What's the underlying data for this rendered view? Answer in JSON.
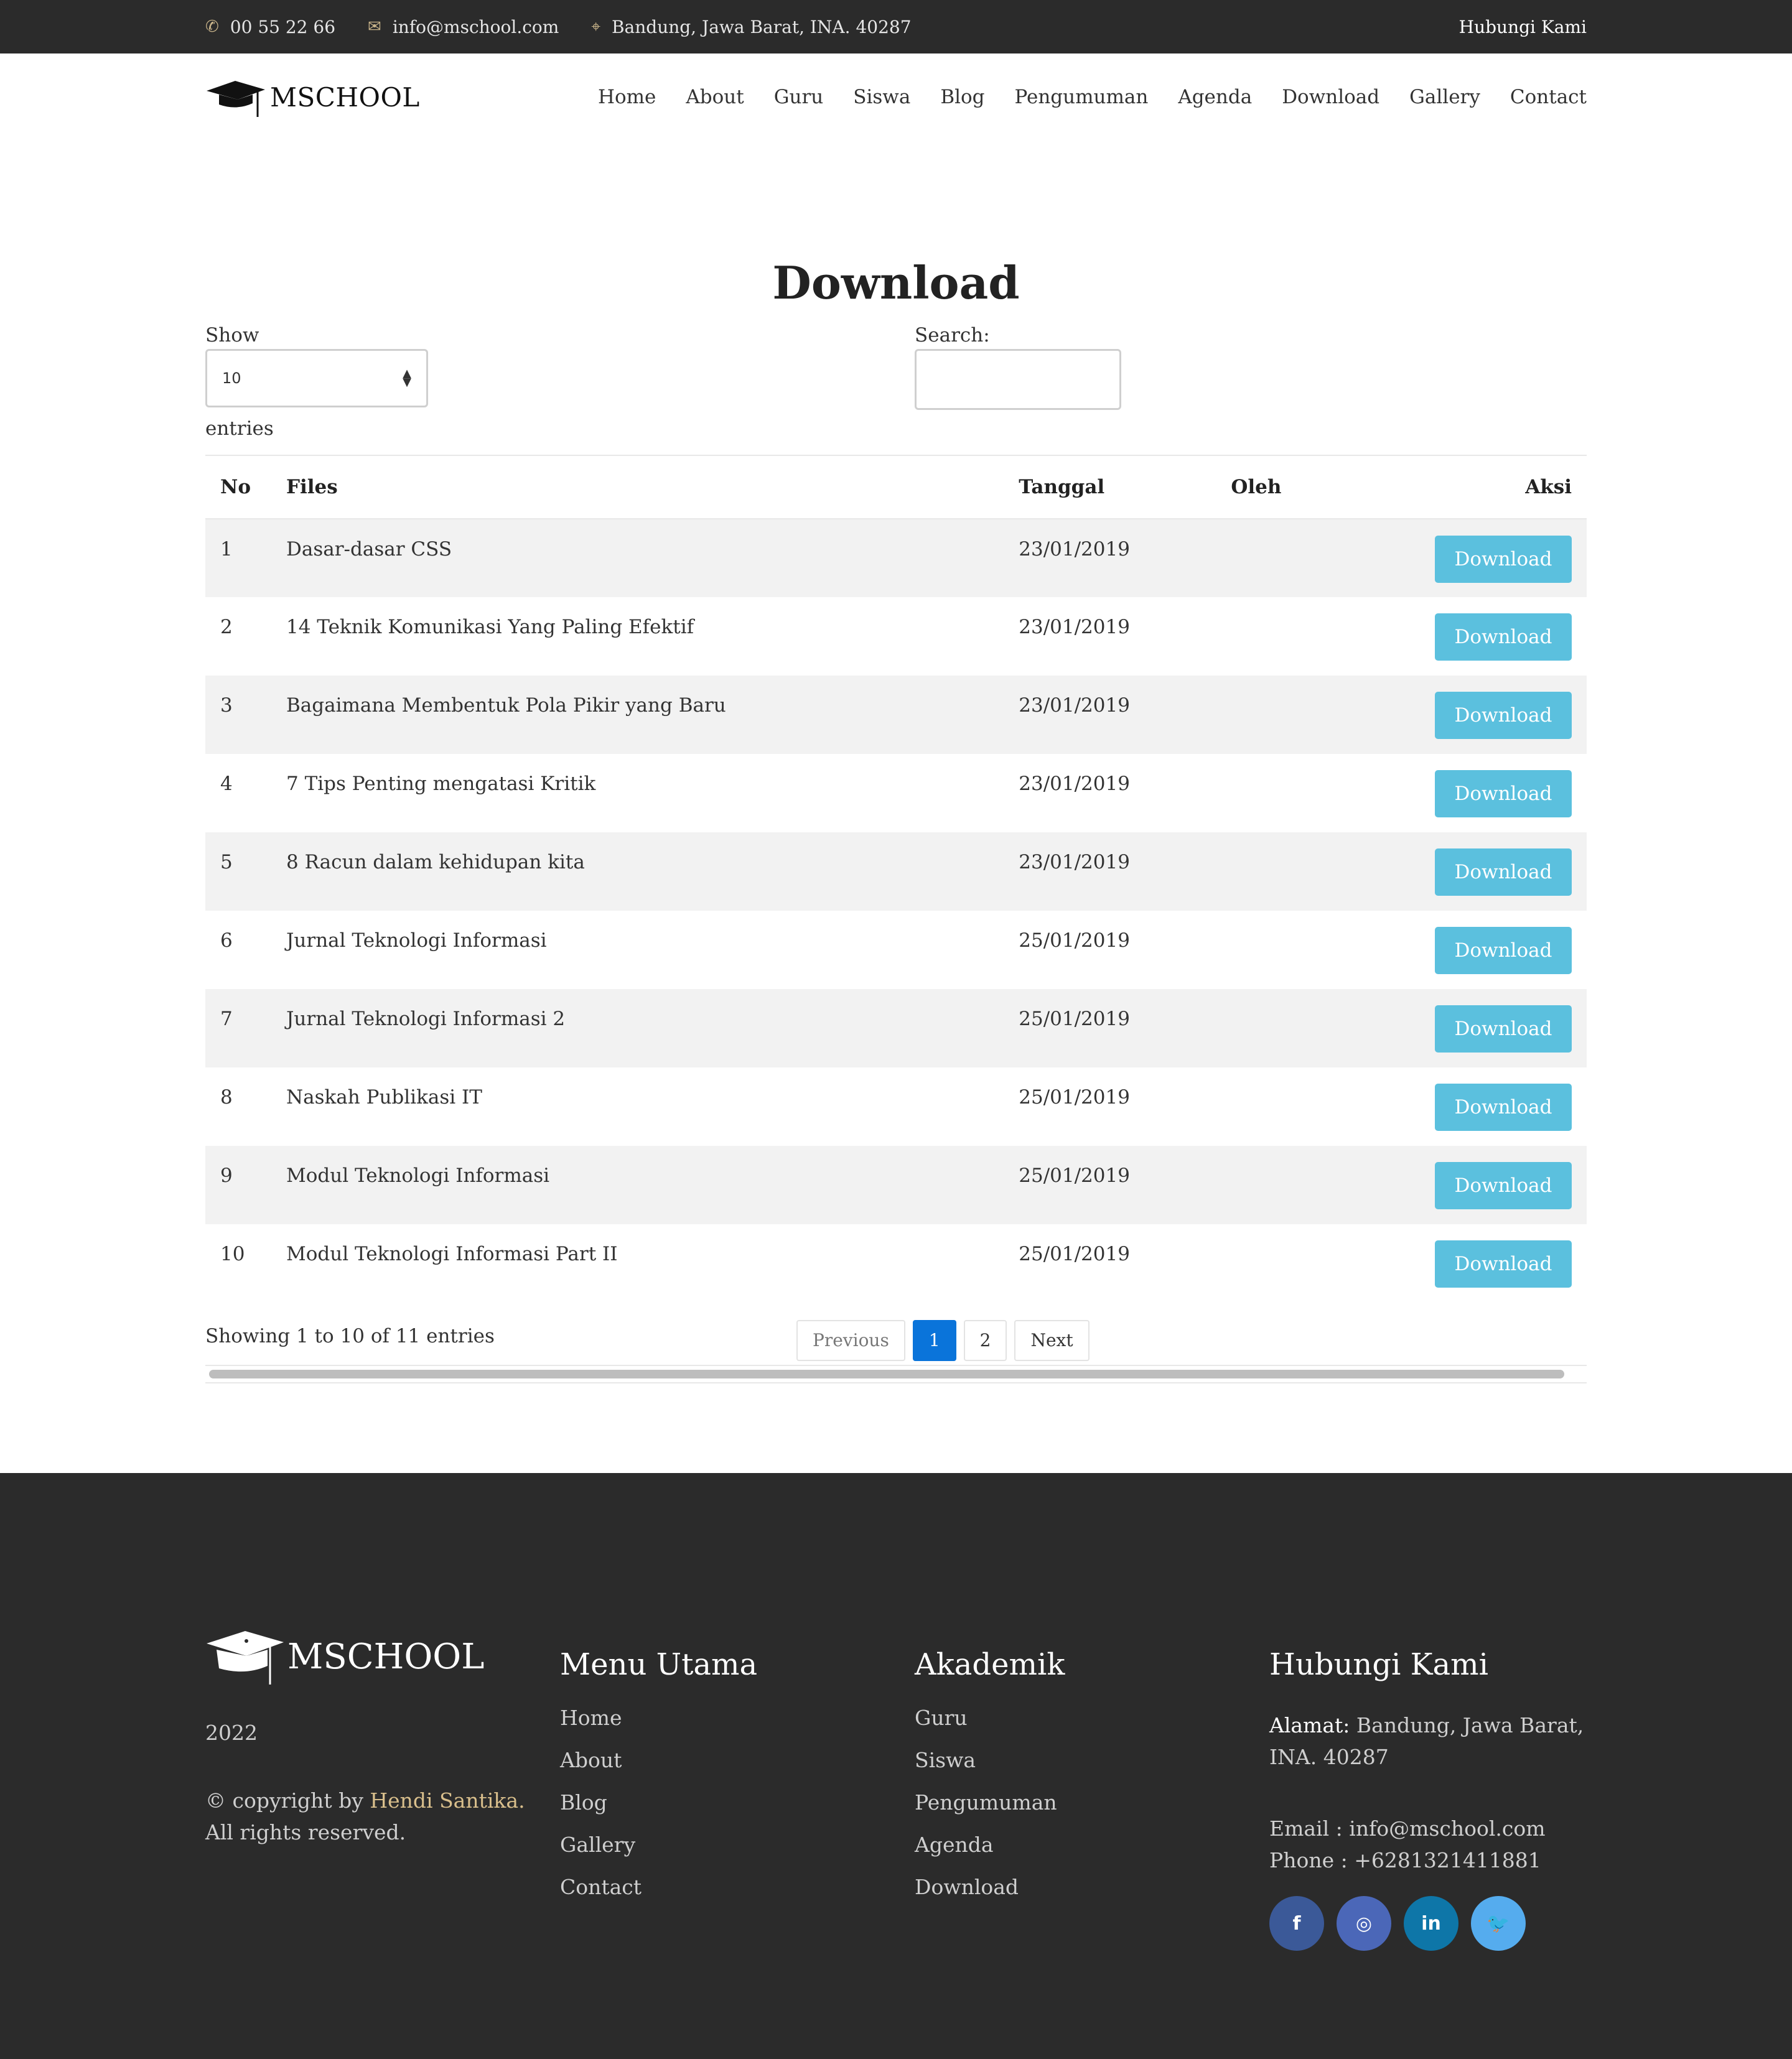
{
  "topbar": {
    "phone": "00 55 22 66",
    "email": "info@mschool.com",
    "address": "Bandung, Jawa Barat, INA. 40287",
    "contact_link": "Hubungi Kami"
  },
  "brand": {
    "name": "MSCHOOL"
  },
  "nav": [
    "Home",
    "About",
    "Guru",
    "Siswa",
    "Blog",
    "Pengumuman",
    "Agenda",
    "Download",
    "Gallery",
    "Contact"
  ],
  "page": {
    "title": "Download",
    "show_label": "Show",
    "show_value": "10",
    "entries_label": "entries",
    "search_label": "Search:",
    "search_value": ""
  },
  "table": {
    "headers": [
      "No",
      "Files",
      "Tanggal",
      "Oleh",
      "Aksi"
    ],
    "rows": [
      {
        "no": "1",
        "file": "Dasar-dasar CSS",
        "date": "23/01/2019",
        "oleh": "",
        "action": "Download"
      },
      {
        "no": "2",
        "file": "14 Teknik Komunikasi Yang Paling Efektif",
        "date": "23/01/2019",
        "oleh": "",
        "action": "Download"
      },
      {
        "no": "3",
        "file": "Bagaimana Membentuk Pola Pikir yang Baru",
        "date": "23/01/2019",
        "oleh": "",
        "action": "Download"
      },
      {
        "no": "4",
        "file": "7 Tips Penting mengatasi Kritik",
        "date": "23/01/2019",
        "oleh": "",
        "action": "Download"
      },
      {
        "no": "5",
        "file": "8 Racun dalam kehidupan kita",
        "date": "23/01/2019",
        "oleh": "",
        "action": "Download"
      },
      {
        "no": "6",
        "file": "Jurnal Teknologi Informasi",
        "date": "25/01/2019",
        "oleh": "",
        "action": "Download"
      },
      {
        "no": "7",
        "file": "Jurnal Teknologi Informasi 2",
        "date": "25/01/2019",
        "oleh": "",
        "action": "Download"
      },
      {
        "no": "8",
        "file": "Naskah Publikasi IT",
        "date": "25/01/2019",
        "oleh": "",
        "action": "Download"
      },
      {
        "no": "9",
        "file": "Modul Teknologi Informasi",
        "date": "25/01/2019",
        "oleh": "",
        "action": "Download"
      },
      {
        "no": "10",
        "file": "Modul Teknologi Informasi Part II",
        "date": "25/01/2019",
        "oleh": "",
        "action": "Download"
      }
    ]
  },
  "pagination": {
    "info": "Showing 1 to 10 of 11 entries",
    "previous": "Previous",
    "pages": [
      "1",
      "2"
    ],
    "active_page": "1",
    "next": "Next"
  },
  "footer": {
    "brand": "MSCHOOL",
    "year": "2022",
    "copyright_prefix": "© copyright by",
    "copyright_author": "Hendi Santika.",
    "copyright_suffix": "All rights reserved.",
    "menu_title": "Menu Utama",
    "menu": [
      "Home",
      "About",
      "Blog",
      "Gallery",
      "Contact"
    ],
    "akademik_title": "Akademik",
    "akademik": [
      "Guru",
      "Siswa",
      "Pengumuman",
      "Agenda",
      "Download"
    ],
    "contact_title": "Hubungi Kami",
    "address_label": "Alamat:",
    "address": "Bandung, Jawa Barat, INA. 40287",
    "email": "Email : info@mschool.com",
    "phone": "Phone : +6281321411881",
    "social": [
      {
        "icon": "facebook-icon",
        "glyph": "f",
        "color": "#3b5998"
      },
      {
        "icon": "instagram-icon",
        "glyph": "◎",
        "color": "#4b67b8"
      },
      {
        "icon": "linkedin-icon",
        "glyph": "in",
        "color": "#0e76a8"
      },
      {
        "icon": "twitter-icon",
        "glyph": "🐦",
        "color": "#55acee"
      }
    ]
  },
  "colors": {
    "dark": "#2b2b2b",
    "accent_gold": "#c9b48a",
    "button": "#5bc0de",
    "active_page": "#0a74da"
  }
}
